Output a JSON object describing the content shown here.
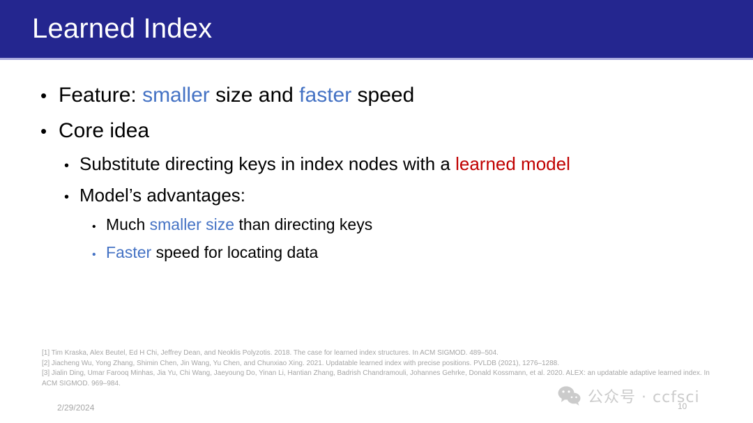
{
  "slide": {
    "title": "Learned Index",
    "header_color": "#24268F",
    "accent_blue": "#4472C4",
    "accent_red": "#C00000"
  },
  "bullets": {
    "feature": {
      "marker": "•",
      "prefix": "Feature: ",
      "blue1": "smaller",
      "mid": " size and ",
      "blue2": "faster",
      "suffix": " speed"
    },
    "core_idea": {
      "marker": "•",
      "text": "Core idea"
    },
    "substitute": {
      "marker": "•",
      "prefix": "Substitute directing keys in index nodes with a ",
      "red": "learned model"
    },
    "advantages": {
      "marker": "•",
      "text": "Model’s advantages:"
    },
    "much_smaller": {
      "marker": "•",
      "prefix": "Much ",
      "blue": "smaller size",
      "suffix": " than directing keys"
    },
    "faster_speed": {
      "marker": "•",
      "blue": "Faster",
      "suffix": " speed for locating data"
    }
  },
  "references": {
    "ref1": "[1] Tim Kraska, Alex Beutel, Ed H Chi, Jeffrey Dean, and Neoklis Polyzotis. 2018. The case for learned index structures. In ACM SIGMOD. 489–504.",
    "ref2": "[2] Jiacheng Wu, Yong Zhang, Shimin Chen, Jin Wang, Yu Chen, and Chunxiao Xing. 2021. Updatable learned index with precise positions. PVLDB (2021), 1276–1288.",
    "ref3": "[3] Jialin Ding, Umar Farooq Minhas, Jia Yu, Chi Wang, Jaeyoung Do, Yinan Li, Hantian Zhang, Badrish Chandramouli, Johannes Gehrke, Donald Kossmann, et al. 2020. ALEX: an updatable adaptive learned index. In ACM SIGMOD. 969–984."
  },
  "footer": {
    "date": "2/29/2024",
    "page_number": "10"
  },
  "watermark": {
    "icon": "wechat-icon",
    "text": "公众号 · ccfsci"
  }
}
